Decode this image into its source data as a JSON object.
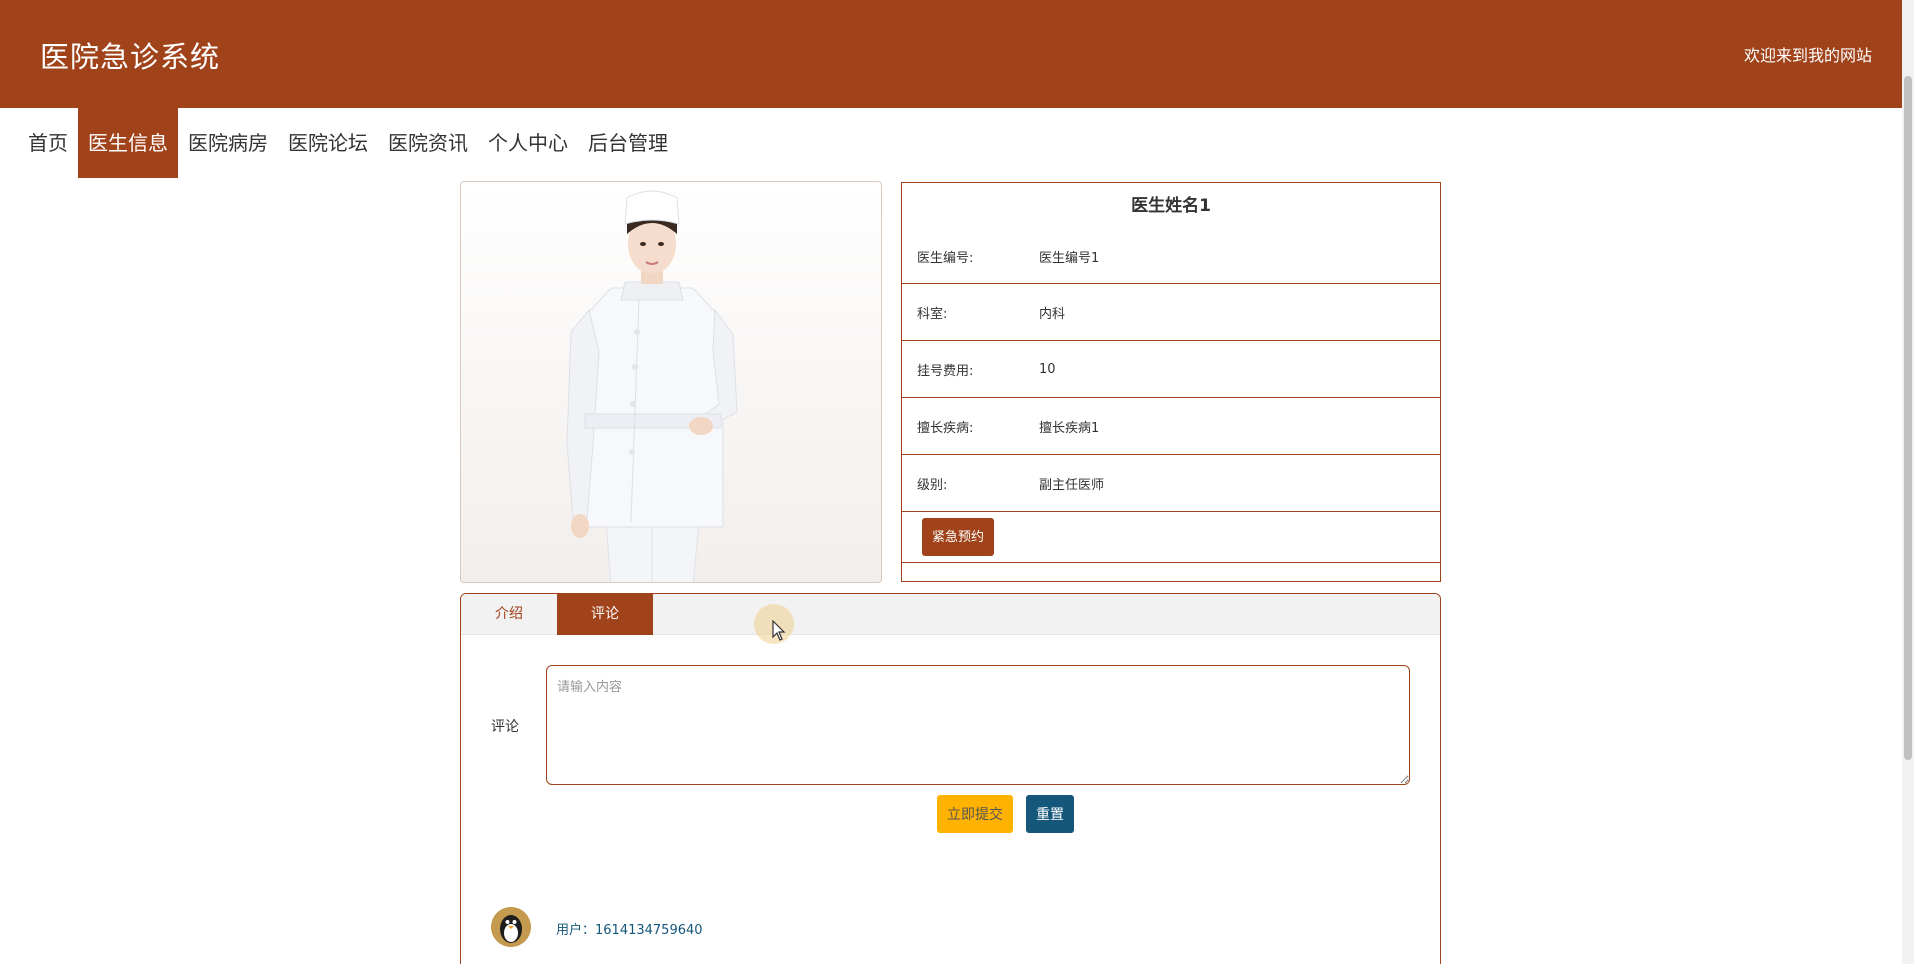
{
  "header": {
    "title": "医院急诊系统",
    "welcome": "欢迎来到我的网站"
  },
  "nav": {
    "items": [
      "首页",
      "医生信息",
      "医院病房",
      "医院论坛",
      "医院资讯",
      "个人中心",
      "后台管理"
    ],
    "active": "医生信息"
  },
  "doctor": {
    "name": "医生姓名1",
    "fields": [
      {
        "label": "医生编号:",
        "value": "医生编号1"
      },
      {
        "label": "科室:",
        "value": "内科"
      },
      {
        "label": "挂号费用:",
        "value": "10"
      },
      {
        "label": "擅长疾病:",
        "value": "擅长疾病1"
      },
      {
        "label": "级别:",
        "value": "副主任医师"
      }
    ],
    "action_label": "紧急预约"
  },
  "tabs": {
    "items": [
      "介绍",
      "评论"
    ],
    "active": "评论"
  },
  "comment_form": {
    "label": "评论",
    "placeholder": "请输入内容",
    "submit_label": "立即提交",
    "reset_label": "重置"
  },
  "comments": [
    {
      "user": "用户：1614134759640"
    }
  ],
  "colors": {
    "brand": "#a0431a",
    "submit": "#ffb300",
    "reset": "#14577a"
  }
}
